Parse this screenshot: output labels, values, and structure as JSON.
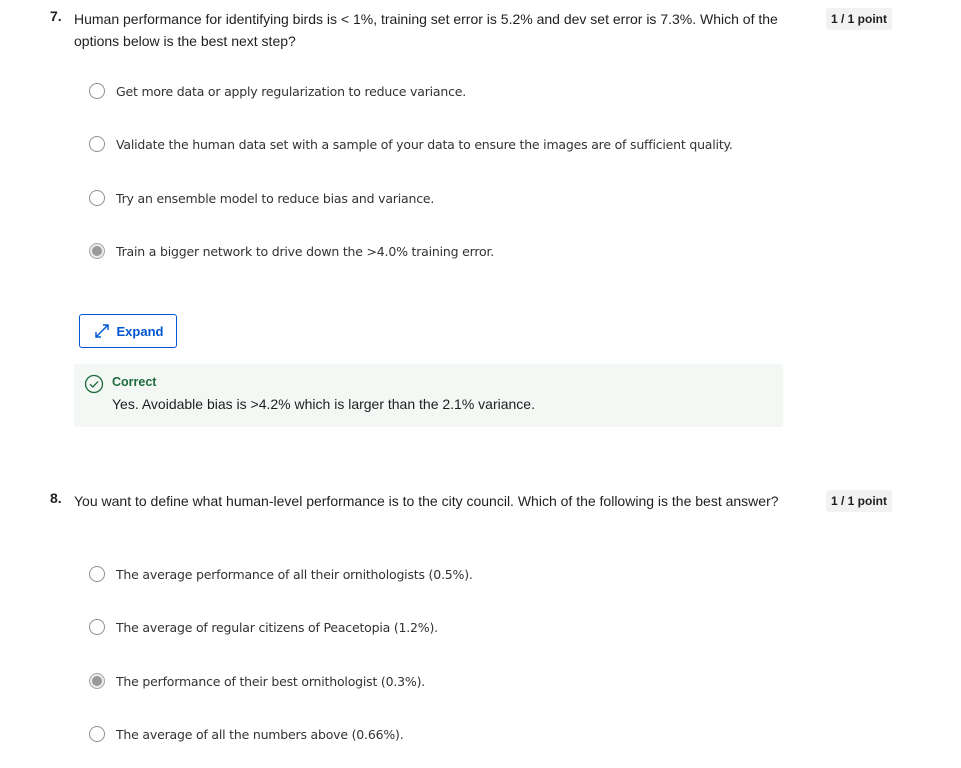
{
  "questions": [
    {
      "number": "7.",
      "text": "Human performance for identifying birds is < 1%, training set error is 5.2% and dev set error is 7.3%. Which of the options below is the best next step?",
      "score": "1 / 1 point",
      "options": [
        {
          "label": "Get more data or apply regularization to reduce variance.",
          "selected": false
        },
        {
          "label": "Validate the human data set with a sample of your data to ensure the images are of sufficient quality.",
          "selected": false
        },
        {
          "label": "Try an ensemble model to reduce bias and variance.",
          "selected": false
        },
        {
          "label": "Train a bigger network to drive down the >4.0% training error.",
          "selected": true
        }
      ],
      "expand_label": "Expand",
      "feedback": {
        "status": "Correct",
        "text": "Yes. Avoidable bias is >4.2% which is larger than the 2.1% variance.",
        "color": "#1e6a3b"
      }
    },
    {
      "number": "8.",
      "text": "You want to define what human-level performance is to the city council. Which of the following is the best answer?",
      "score": "1 / 1 point",
      "options": [
        {
          "label": "The average performance of all their ornithologists (0.5%).",
          "selected": false
        },
        {
          "label": "The average of regular citizens of Peacetopia (1.2%).",
          "selected": false
        },
        {
          "label": "The performance of their best ornithologist (0.3%).",
          "selected": true
        },
        {
          "label": "The average of all the numbers above (0.66%).",
          "selected": false
        }
      ]
    }
  ],
  "colors": {
    "accent": "#0056d2",
    "correct": "#1e6a3b",
    "feedback_bg": "#f3f8f5",
    "badge_bg": "#f2f2f2"
  },
  "icons": {
    "expand": "expand-arrows-icon",
    "correct": "check-circle-icon"
  }
}
